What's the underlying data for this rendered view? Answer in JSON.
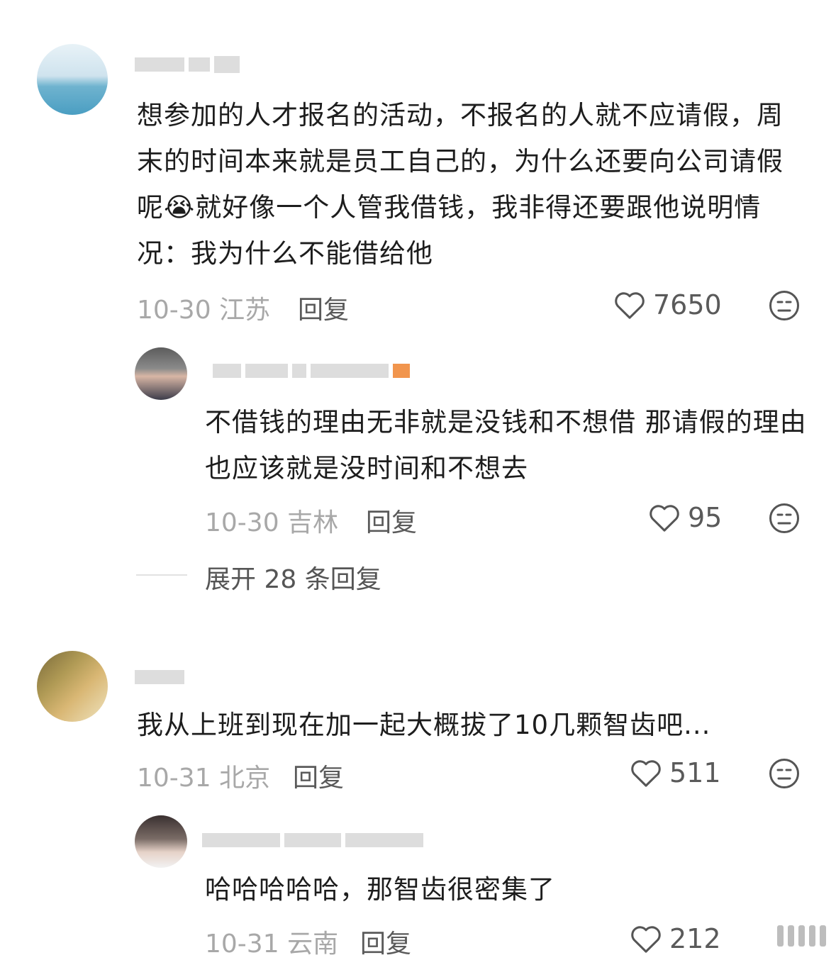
{
  "comments": [
    {
      "text": "想参加的人才报名的活动，不报名的人就不应请假，周末的时间本来就是员工自己的，为什么还要向公司请假呢😭就好像一个人管我借钱，我非得还要跟他说明情况：我为什么不能借给他",
      "date": "10-30",
      "location": "江苏",
      "reply_label": "回复",
      "likes": "7650",
      "replies": [
        {
          "text": "不借钱的理由无非就是没钱和不想借 那请假的理由也应该就是没时间和不想去",
          "date": "10-30",
          "location": "吉林",
          "reply_label": "回复",
          "likes": "95"
        }
      ],
      "expand_label": "展开 28 条回复"
    },
    {
      "text": "我从上班到现在加一起大概拔了10几颗智齿吧...",
      "date": "10-31",
      "location": "北京",
      "reply_label": "回复",
      "likes": "511",
      "replies": [
        {
          "text": "哈哈哈哈哈，那智齿很密集了",
          "date": "10-31",
          "location": "云南",
          "reply_label": "回复",
          "likes": "212"
        }
      ]
    }
  ]
}
